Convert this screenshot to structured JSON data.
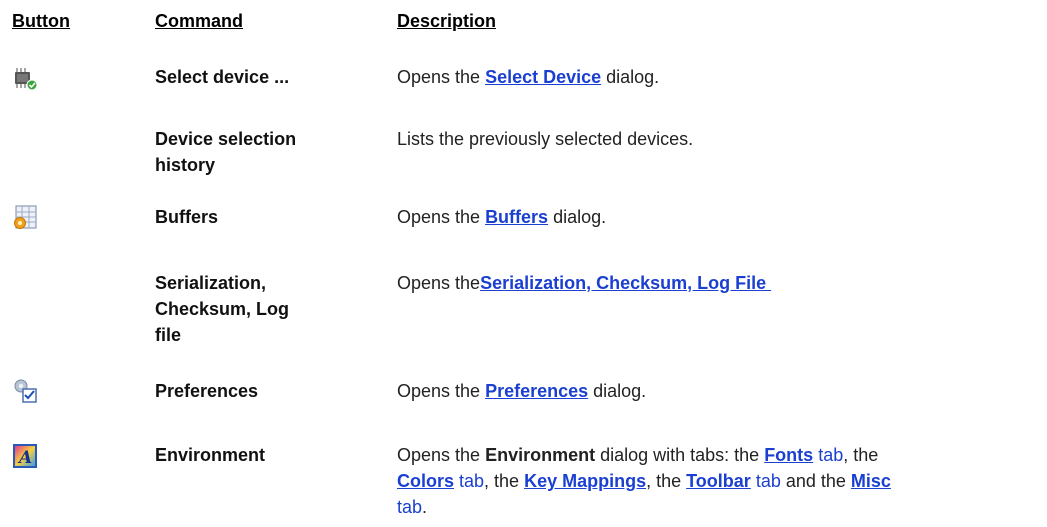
{
  "headers": {
    "button": "Button",
    "command": "Command",
    "description": "Description"
  },
  "colors": {
    "link": "#1a3fd1",
    "text": "#222222"
  },
  "rows": [
    {
      "icon": "chip-select-icon",
      "command": "Select device ...",
      "desc_pre": "Opens the ",
      "desc_link": "Select Device",
      "desc_post": " dialog."
    },
    {
      "icon": "",
      "command_line1": "Device selection",
      "command_line2": "history",
      "desc": "Lists the previously selected devices."
    },
    {
      "icon": "buffers-grid-gear-icon",
      "command": "Buffers",
      "desc_pre": "Opens the ",
      "desc_link": "Buffers",
      "desc_post": " dialog."
    },
    {
      "icon": "",
      "command_line1": "Serialization,",
      "command_line2": "Checksum, Log",
      "command_line3": "file",
      "desc_pre": "Opens the",
      "desc_link": "Serialization, Checksum, Log File "
    },
    {
      "icon": "preferences-gear-check-icon",
      "command": "Preferences",
      "desc_pre": "Opens the ",
      "desc_link": "Preferences",
      "desc_post": " dialog."
    },
    {
      "icon": "environment-a-icon",
      "command": "Environment",
      "desc_p1": "Opens the ",
      "desc_bold": "Environment",
      "desc_p2": " dialog with tabs: the ",
      "link_fonts": "Fonts",
      "tab1": " tab",
      "desc_p3": ", the",
      "link_colors": "Colors",
      "tab2": " tab",
      "desc_p4": ", the ",
      "link_keymap": "Key Mappings",
      "desc_p5": ", the ",
      "link_toolbar": "Toolbar",
      "tab3": " tab",
      "desc_p6": " and the ",
      "link_misc": "Misc",
      "tab4": "tab",
      "desc_p7": "."
    }
  ]
}
